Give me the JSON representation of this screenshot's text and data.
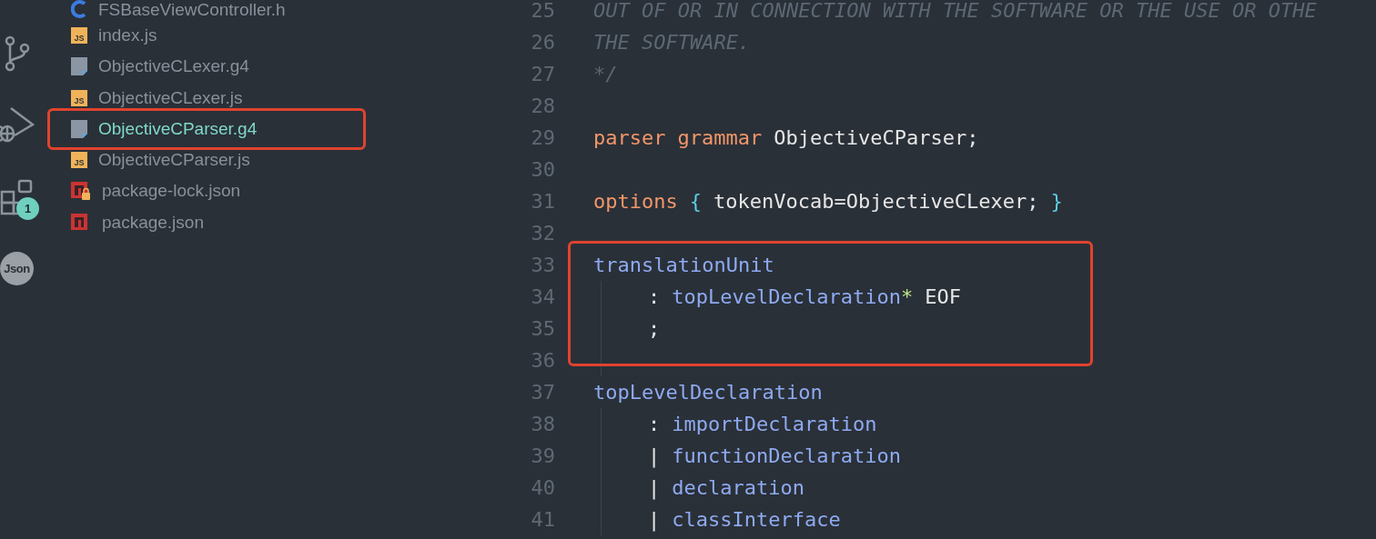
{
  "activity_bar": [
    {
      "kind": "git"
    },
    {
      "kind": "debug"
    },
    {
      "kind": "extensions",
      "badge": "1"
    },
    {
      "kind": "json",
      "label": "Json"
    }
  ],
  "files": [
    {
      "name": "FSBaseViewController.h",
      "kind": "c",
      "selected": false,
      "highlighted": false
    },
    {
      "name": "index.js",
      "kind": "js",
      "icon_label": "JS",
      "selected": false,
      "highlighted": false
    },
    {
      "name": "ObjectiveCLexer.g4",
      "kind": "grammar",
      "selected": false,
      "highlighted": false
    },
    {
      "name": "ObjectiveCLexer.js",
      "kind": "js",
      "icon_label": "JS",
      "selected": false,
      "highlighted": false
    },
    {
      "name": "ObjectiveCParser.g4",
      "kind": "grammar",
      "selected": true,
      "highlighted": true
    },
    {
      "name": "ObjectiveCParser.js",
      "kind": "js",
      "icon_label": "JS",
      "selected": false,
      "highlighted": false
    },
    {
      "name": "package-lock.json",
      "kind": "locked-package",
      "selected": false,
      "highlighted": false
    },
    {
      "name": "package.json",
      "kind": "package",
      "selected": false,
      "highlighted": false
    }
  ],
  "editor": {
    "blocks": [
      {
        "highlighted": false,
        "lines": [
          {
            "number": "25",
            "indented": false,
            "tokens": [
              {
                "text": "OUT OF OR IN CONNECTION WITH THE SOFTWARE OR THE USE OR OTHE",
                "kind": "comment"
              }
            ]
          },
          {
            "number": "26",
            "indented": false,
            "tokens": [
              {
                "text": "THE SOFTWARE.",
                "kind": "comment"
              }
            ]
          },
          {
            "number": "27",
            "indented": false,
            "tokens": [
              {
                "text": "*/",
                "kind": "comment"
              }
            ]
          },
          {
            "number": "28",
            "indented": false
          },
          {
            "number": "29",
            "indented": false,
            "tokens": [
              {
                "text": "parser",
                "kind": "keyword"
              },
              {
                "text": "grammar",
                "kind": "keyword"
              },
              {
                "text": "ObjectiveCParser;",
                "kind": "plain"
              }
            ]
          },
          {
            "number": "30",
            "indented": false
          },
          {
            "number": "31",
            "indented": false,
            "tokens": [
              {
                "text": "options",
                "kind": "keyword"
              },
              {
                "text": "{",
                "kind": "brace"
              },
              {
                "text": "tokenVocab=ObjectiveCLexer;",
                "kind": "plain"
              },
              {
                "text": "}",
                "kind": "brace"
              }
            ]
          },
          {
            "number": "32",
            "indented": false
          }
        ]
      },
      {
        "highlighted": true,
        "lines": [
          {
            "number": "33",
            "indented": false,
            "tokens": [
              {
                "text": "translationUnit",
                "kind": "rule"
              }
            ]
          },
          {
            "number": "34",
            "indented": true,
            "tokens": [
              {
                "text": ":",
                "kind": "plain"
              },
              {
                "text": "topLevelDeclaration",
                "kind": "rule",
                "joined": true
              },
              {
                "text": "*",
                "kind": "operator"
              },
              {
                "text": "EOF",
                "kind": "plain"
              }
            ]
          },
          {
            "number": "35",
            "indented": true,
            "tokens": [
              {
                "text": ";",
                "kind": "plain"
              }
            ]
          },
          {
            "number": "36",
            "indented": true
          }
        ]
      },
      {
        "highlighted": false,
        "lines": [
          {
            "number": "37",
            "indented": false,
            "tokens": [
              {
                "text": "topLevelDeclaration",
                "kind": "rule"
              }
            ]
          },
          {
            "number": "38",
            "indented": true,
            "tokens": [
              {
                "text": ":",
                "kind": "plain"
              },
              {
                "text": "importDeclaration",
                "kind": "rule"
              }
            ]
          },
          {
            "number": "39",
            "indented": true,
            "tokens": [
              {
                "text": "|",
                "kind": "plain"
              },
              {
                "text": "functionDeclaration",
                "kind": "rule"
              }
            ]
          },
          {
            "number": "40",
            "indented": true,
            "tokens": [
              {
                "text": "|",
                "kind": "plain"
              },
              {
                "text": "declaration",
                "kind": "rule"
              }
            ]
          },
          {
            "number": "41",
            "indented": true,
            "tokens": [
              {
                "text": "|",
                "kind": "plain"
              },
              {
                "text": "classInterface",
                "kind": "rule"
              }
            ]
          }
        ]
      }
    ]
  }
}
